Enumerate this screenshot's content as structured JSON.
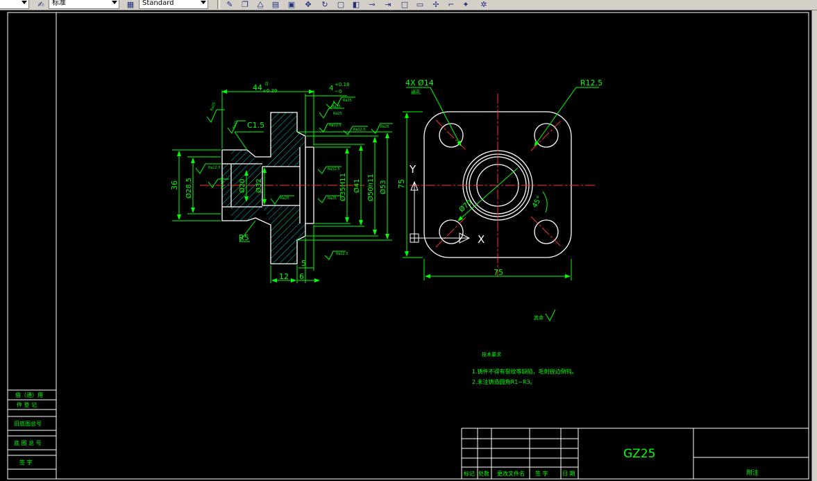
{
  "toolbar": {
    "style_value": "标准",
    "text_style_value": "Standard"
  },
  "drawing": {
    "dims": {
      "len44": "44",
      "tol44_upper": "0",
      "tol44_lower": "+0.39",
      "len4": "4",
      "tol4_upper": "+0.18",
      "tol4_lower": "−0",
      "chamfer": "C1.5",
      "r5": "R5",
      "d36": "36",
      "d28": "Ø28.5",
      "d20": "Ø20",
      "d32": "Ø32",
      "d35": "Ø35H11",
      "d41": "Ø41",
      "d50": "Ø50h11",
      "d53": "Ø53",
      "w12": "12",
      "w6": "6",
      "w5": "5",
      "holes": "4X Ø14",
      "holes_note": "通孔",
      "r12": "R12.5",
      "side75_v": "75",
      "side75_h": "75",
      "d70": "Ø70",
      "angle": "45°",
      "axis_y": "Y",
      "axis_x": "X"
    },
    "ra_labels": {
      "ra1": "Ra25",
      "ra2": "Ra25",
      "ra3": "Ra25",
      "ra4": "Ra12.5",
      "ra5": "Ra25",
      "ra6": "Ra12.5",
      "ra7": "Ra25",
      "ra8": "Ra12.5",
      "ra9": "Ra12.5",
      "ra10": "Ra25",
      "ra11": "Ra12.5",
      "ra12": "Ra25",
      "ra13": "Ra12.5",
      "ra14": "Ra25"
    },
    "remaining_finish": "其余",
    "notes": {
      "title": "技术要求",
      "line1": "1.铸件不得有裂纹等缺陷，毛刺锐边倒钝。",
      "line2": "2.未注铸造圆角R1~R3。"
    },
    "title_block": {
      "part_no": "GZ25",
      "part_name": "附注",
      "h_mark": "标记",
      "h_qty": "处数",
      "h_doc": "更改文件名",
      "h_sign": "签 字",
      "h_date": "日 期"
    },
    "side_block": {
      "r1": "借（通）用",
      "r2": "件 登 记",
      "r3": "旧底图总号",
      "r4": "底 图 总 号",
      "r5": "签 字"
    }
  },
  "colors": {
    "outline": "#ffffff",
    "dimension": "#00ff00",
    "center": "#ff3030",
    "hatch": "#00c8c8",
    "background": "#000000"
  }
}
